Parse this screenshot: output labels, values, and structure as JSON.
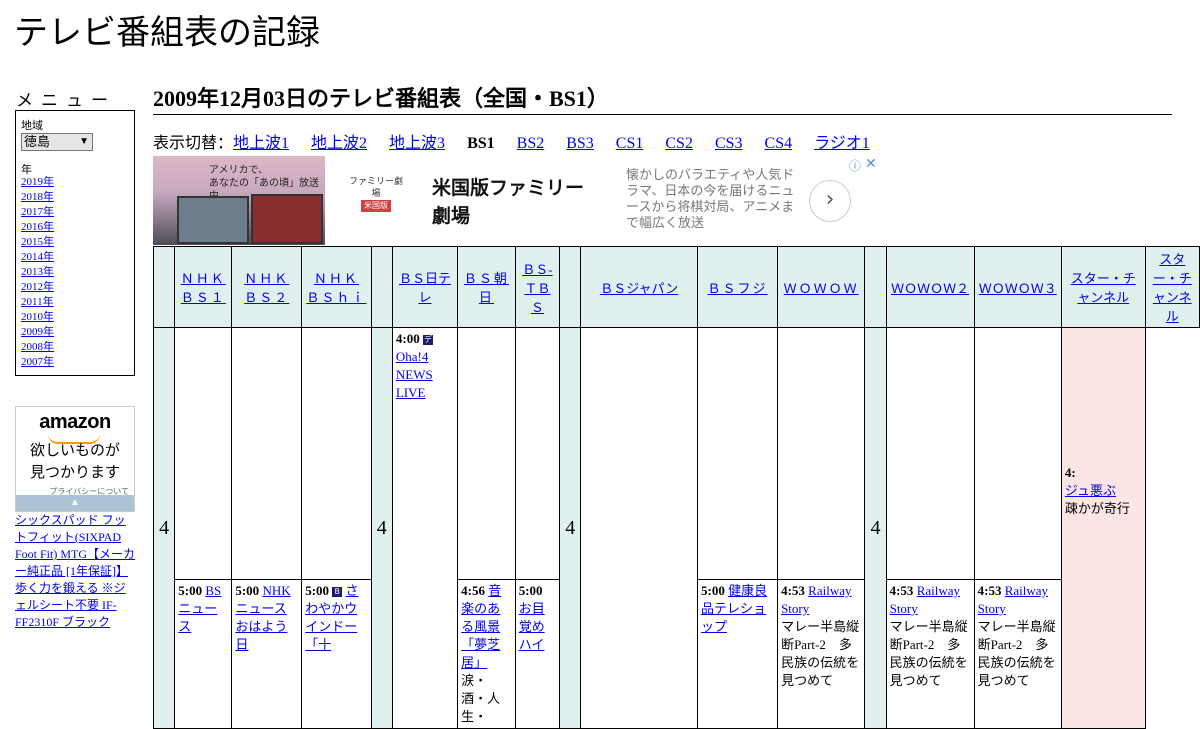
{
  "site": {
    "title": "テレビ番組表の記録"
  },
  "menu": {
    "title": "メニュー",
    "region_label": "地域",
    "region_value": "徳島",
    "year_label": "年",
    "years": [
      "2019年",
      "2018年",
      "2017年",
      "2016年",
      "2015年",
      "2014年",
      "2013年",
      "2012年",
      "2011年",
      "2010年",
      "2009年",
      "2008年",
      "2007年"
    ]
  },
  "amazon": {
    "logo": "amazon",
    "tagline_1": "欲しいものが",
    "tagline_2": "見つかります",
    "privacy": "プライバシーについて",
    "product": "シックスパッド フットフィット(SIXPAD Foot Fit) MTG【メーカー純正品 [1年保証]】歩く力を鍛える ※ジェルシート不要 IF-FF2310F ブラック"
  },
  "heading": "2009年12月03日のテレビ番組表（全国・BS1）",
  "switcher": {
    "label": "表示切替：",
    "links": [
      "地上波1",
      "地上波2",
      "地上波3"
    ],
    "current": "BS1",
    "links2": [
      "BS2",
      "BS3",
      "CS1",
      "CS2",
      "CS3",
      "CS4",
      "ラジオ1"
    ]
  },
  "ad": {
    "photo_text_1": "アメリカで、",
    "photo_text_2": "あなたの「あの頃」放送中。",
    "logo_text": "ファミリー劇場",
    "logo_badge": "米国版",
    "headline_1": "米国版ファミリー",
    "headline_2": "劇場",
    "description": "懐かしのバラエティや人気ドラマ、日本の今を届けるニュースから将棋対局、アニメまで幅広く放送",
    "next": "›",
    "info": "ⓘ",
    "close": "✕"
  },
  "grid": {
    "hour": "4",
    "channels": [
      "ＮＨＫ ＢＳ１",
      "ＮＨＫ ＢＳ２",
      "ＮＨＫ ＢＳｈｉ",
      "ＢＳ日テレ",
      "ＢＳ朝日",
      "ＢＳ-ＴＢＳ",
      "ＢＳジャパン",
      "ＢＳフジ",
      "ＷＯＷＯＷ",
      "ＷＯＷＯＷ２",
      "ＷＯＷＯＷ３",
      "スター・チャンネル"
    ],
    "programs": {
      "ntv_400": {
        "time": "4:00",
        "title": "Oha!4 NEWS LIVE"
      },
      "wowow_453": {
        "time": "4:53",
        "title": "Railway Story",
        "desc": "マレー半島縦断Part-2　多民族の伝統を見つめて"
      },
      "wowow2_453": {
        "time": "4:53",
        "title": "Railway Story",
        "desc": "マレー半島縦断Part-2　多民族の伝統を見つめて"
      },
      "wowow3_453": {
        "time": "4:53",
        "title": "Railway Story",
        "desc": "マレー半島縦断Part-2　多民族の伝統を見つめて"
      },
      "asahi_456": {
        "time": "4:56",
        "title": "音楽のある風景 「夢芝居」",
        "desc": "涙・酒・人生・"
      },
      "bs1_500": {
        "time": "5:00",
        "title": "BSニュース"
      },
      "bs2_500": {
        "time": "5:00",
        "title": "NHKニュース おはよう日"
      },
      "hi_500": {
        "time": "5:00",
        "title": "さわやかウインドー「十"
      },
      "tbs_500": {
        "time": "5:00",
        "title": "お目覚めハイ"
      },
      "fuji_500": {
        "time": "5:00",
        "title": "健康良品テレショップ"
      },
      "star_4": {
        "time": "4:",
        "title": "ジュ悪ぶ",
        "desc": "疎かが奇行"
      }
    }
  }
}
